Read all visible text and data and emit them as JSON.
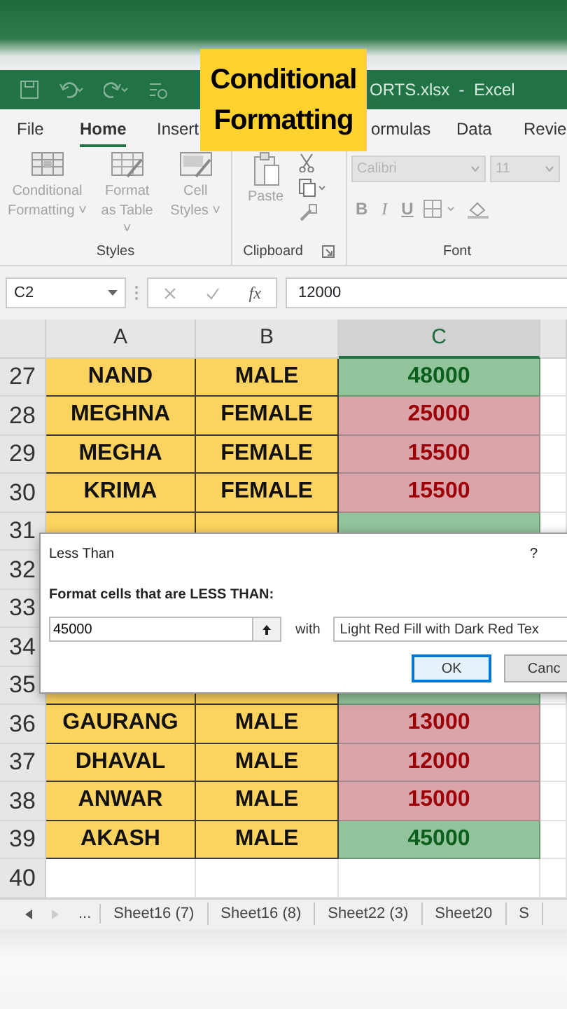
{
  "overlay_caption": "Conditional Formatting",
  "title_bar": {
    "title": "ORTS.xlsx  -  Excel"
  },
  "ribbon_tabs": [
    {
      "label": "File",
      "selected": false
    },
    {
      "label": "Home",
      "selected": true
    },
    {
      "label": "Insert",
      "selected": false
    },
    {
      "label": "ormulas",
      "selected": false
    },
    {
      "label": "Data",
      "selected": false
    },
    {
      "label": "Revie",
      "selected": false
    }
  ],
  "ribbon": {
    "groups": [
      {
        "label": "Styles",
        "kind": "styles",
        "buttons": [
          {
            "label": "Conditional Formatting ˅"
          },
          {
            "label": "Format as Table ˅"
          },
          {
            "label": "Cell Styles ˅"
          }
        ]
      },
      {
        "label": "Clipboard",
        "kind": "clipboard",
        "buttons": [
          {
            "label": "Paste"
          }
        ]
      },
      {
        "label": "Font",
        "kind": "font",
        "font_name": "Calibri",
        "font_size": "11",
        "buttons": [
          {
            "label": "B"
          },
          {
            "label": "I"
          },
          {
            "label": "U"
          }
        ]
      }
    ]
  },
  "formula_bar": {
    "name_box": "C2",
    "function_label": "fx",
    "value": "12000"
  },
  "sheet": {
    "columns": [
      "A",
      "B",
      "C"
    ],
    "rows": [
      {
        "number": "27",
        "cells": [
          {
            "text": "NAND",
            "kind": "highlight"
          },
          {
            "text": "MALE",
            "kind": "highlight"
          },
          {
            "text": "48000",
            "kind": "good"
          }
        ]
      },
      {
        "number": "28",
        "cells": [
          {
            "text": "MEGHNA",
            "kind": "highlight"
          },
          {
            "text": "FEMALE",
            "kind": "highlight"
          },
          {
            "text": "25000",
            "kind": "bad"
          }
        ]
      },
      {
        "number": "29",
        "cells": [
          {
            "text": "MEGHA",
            "kind": "highlight"
          },
          {
            "text": "FEMALE",
            "kind": "highlight"
          },
          {
            "text": "15500",
            "kind": "bad"
          }
        ]
      },
      {
        "number": "30",
        "cells": [
          {
            "text": "KRIMA",
            "kind": "highlight"
          },
          {
            "text": "FEMALE",
            "kind": "highlight"
          },
          {
            "text": "15500",
            "kind": "bad"
          }
        ]
      },
      {
        "number": "31",
        "cells": [
          {
            "kind": "highlight"
          },
          {
            "kind": "highlight"
          },
          {
            "kind": "good"
          }
        ]
      },
      {
        "number": "32"
      },
      {
        "number": "33"
      },
      {
        "number": "34"
      },
      {
        "number": "35",
        "cells": [
          {
            "kind": "highlight"
          },
          {
            "kind": "highlight"
          },
          {
            "kind": "good"
          }
        ]
      },
      {
        "number": "36",
        "cells": [
          {
            "text": "GAURANG",
            "kind": "highlight"
          },
          {
            "text": "MALE",
            "kind": "highlight"
          },
          {
            "text": "13000",
            "kind": "bad"
          }
        ]
      },
      {
        "number": "37",
        "cells": [
          {
            "text": "DHAVAL",
            "kind": "highlight"
          },
          {
            "text": "MALE",
            "kind": "highlight"
          },
          {
            "text": "12000",
            "kind": "bad"
          }
        ]
      },
      {
        "number": "38",
        "cells": [
          {
            "text": "ANWAR",
            "kind": "highlight"
          },
          {
            "text": "MALE",
            "kind": "highlight"
          },
          {
            "text": "15000",
            "kind": "bad"
          }
        ]
      },
      {
        "number": "39",
        "cells": [
          {
            "text": "AKASH",
            "kind": "highlight"
          },
          {
            "text": "MALE",
            "kind": "highlight"
          },
          {
            "text": "45000",
            "kind": "good"
          }
        ]
      },
      {
        "number": "40",
        "cells": [
          {
            "kind": "plain"
          },
          {
            "kind": "plain"
          },
          {
            "kind": "plain"
          }
        ]
      }
    ]
  },
  "dialog": {
    "title": "Less Than",
    "help": "?",
    "prompt": "Format cells that are LESS THAN:",
    "value": "45000",
    "with_label": "with",
    "format": "Light Red Fill with Dark Red Tex",
    "buttons": [
      {
        "label": "OK",
        "default": true
      },
      {
        "label": "Canc",
        "default": false
      }
    ]
  },
  "sheet_tabs": {
    "more": "...",
    "tabs": [
      {
        "label": "Sheet16 (7)"
      },
      {
        "label": "Sheet16 (8)"
      },
      {
        "label": "Sheet22 (3)"
      },
      {
        "label": "Sheet20"
      },
      {
        "label": "S"
      }
    ]
  }
}
